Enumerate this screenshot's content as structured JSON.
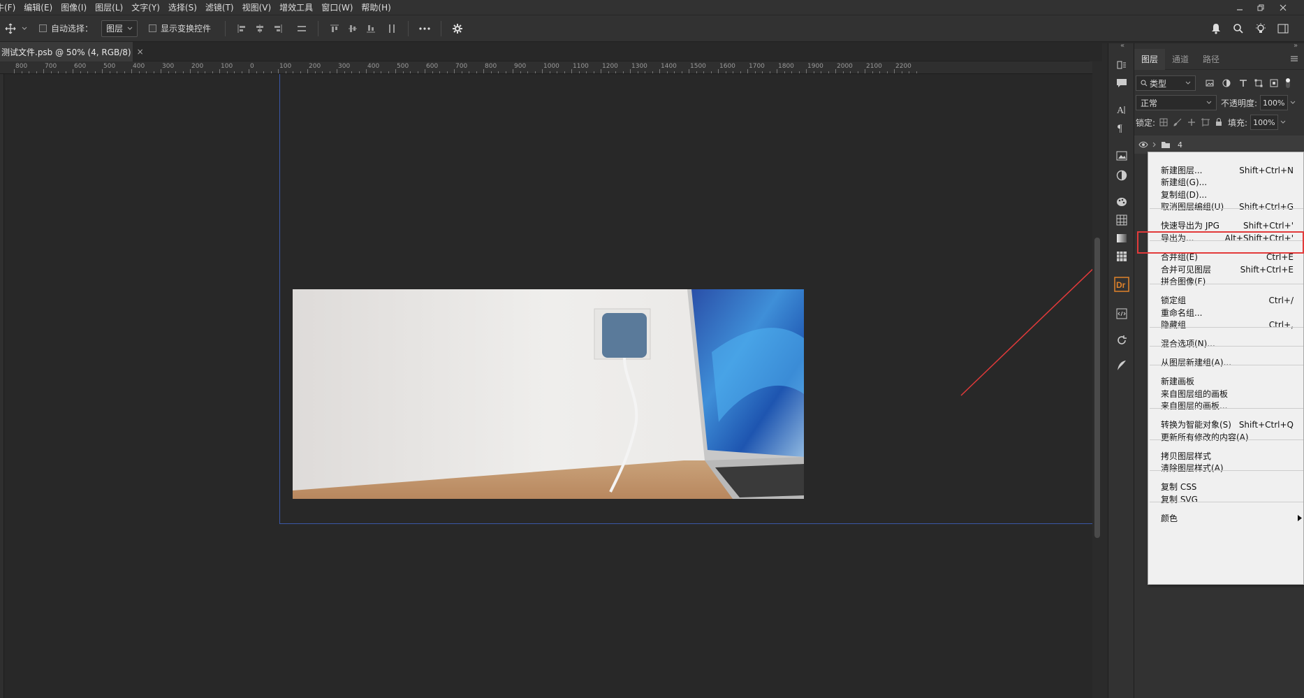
{
  "menubar": {
    "items": [
      "牛(F)",
      "编辑(E)",
      "图像(I)",
      "图层(L)",
      "文字(Y)",
      "选择(S)",
      "滤镜(T)",
      "视图(V)",
      "增效工具",
      "窗口(W)",
      "帮助(H)"
    ]
  },
  "options": {
    "auto_select_label": "自动选择：",
    "auto_select_value": "图层",
    "show_transform_label": "显示变换控件"
  },
  "document": {
    "tab_title": "测试文件.psb @ 50% (4, RGB/8)",
    "close": "×"
  },
  "ruler": {
    "ticks": [
      "800",
      "700",
      "600",
      "500",
      "400",
      "300",
      "200",
      "100",
      "0",
      "100",
      "200",
      "300",
      "400",
      "500",
      "600",
      "700",
      "800",
      "900",
      "1000",
      "1100",
      "1200",
      "1300",
      "1400",
      "1500",
      "1600",
      "1700",
      "1800",
      "1900",
      "2000",
      "2100",
      "2200"
    ]
  },
  "panel": {
    "tabs": [
      "图层",
      "通道",
      "路径"
    ],
    "filter_label": "类型",
    "blend_mode": "正常",
    "opacity_label": "不透明度:",
    "opacity_value": "100%",
    "lock_label": "锁定:",
    "fill_label": "填充:",
    "fill_value": "100%",
    "layer_name": "4"
  },
  "context_menu": {
    "items": [
      {
        "label": "新建图层...",
        "shortcut": "Shift+Ctrl+N"
      },
      {
        "label": "新建组(G)...",
        "shortcut": ""
      },
      {
        "label": "复制组(D)...",
        "shortcut": ""
      },
      {
        "label": "取消图层编组(U)",
        "shortcut": "Shift+Ctrl+G"
      },
      {
        "label": "快速导出为 JPG",
        "shortcut": "Shift+Ctrl+'"
      },
      {
        "label": "导出为...",
        "shortcut": "Alt+Shift+Ctrl+'"
      },
      {
        "label": "合并组(E)",
        "shortcut": "Ctrl+E"
      },
      {
        "label": "合并可见图层",
        "shortcut": "Shift+Ctrl+E"
      },
      {
        "label": "拼合图像(F)",
        "shortcut": ""
      },
      {
        "label": "锁定组",
        "shortcut": "Ctrl+/"
      },
      {
        "label": "重命名组...",
        "shortcut": ""
      },
      {
        "label": "隐藏组",
        "shortcut": "Ctrl+,"
      },
      {
        "label": "混合选项(N)...",
        "shortcut": ""
      },
      {
        "label": "从图层新建组(A)...",
        "shortcut": ""
      },
      {
        "label": "新建画板",
        "shortcut": ""
      },
      {
        "label": "来自图层组的画板",
        "shortcut": ""
      },
      {
        "label": "来自图层的画板...",
        "shortcut": ""
      },
      {
        "label": "转换为智能对象(S)",
        "shortcut": "Shift+Ctrl+Q"
      },
      {
        "label": "更新所有修改的内容(A)",
        "shortcut": ""
      },
      {
        "label": "拷贝图层样式",
        "shortcut": ""
      },
      {
        "label": "清除图层样式(A)",
        "shortcut": ""
      },
      {
        "label": "复制 CSS",
        "shortcut": ""
      },
      {
        "label": "复制 SVG",
        "shortcut": ""
      },
      {
        "label": "颜色",
        "shortcut": ""
      }
    ],
    "highlighted": "导出为..."
  },
  "colors": {
    "annotation": "#e23a3a",
    "artboard_border": "#3a57a8",
    "background": "#282828"
  }
}
